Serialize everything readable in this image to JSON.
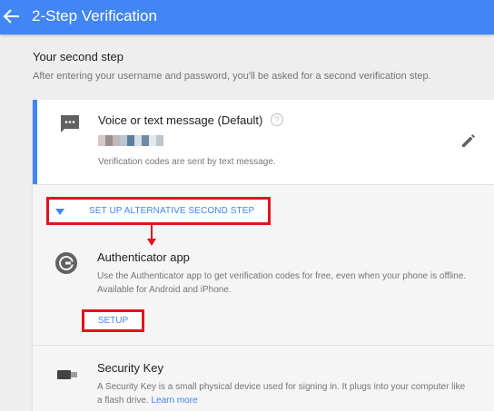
{
  "header": {
    "title": "2-Step Verification",
    "bg_color": "#4285f4"
  },
  "section": {
    "title": "Your second step",
    "subtitle": "After entering your username and password, you'll be asked for a second verification step."
  },
  "primary_method": {
    "title": "Voice or text message (Default)",
    "help_glyph": "?",
    "phone_number_redacted": true,
    "description": "Verification codes are sent by text message.",
    "icons": [
      "message-icon",
      "help-icon",
      "pencil-icon"
    ]
  },
  "alternative": {
    "toggle_label": "SET UP ALTERNATIVE SECOND STEP",
    "methods": [
      {
        "title": "Authenticator app",
        "desc_line1": "Use the Authenticator app to get verification codes for free, even when your phone is offline.",
        "desc_line2": "Available for Android and iPhone.",
        "action_label": "SETUP",
        "icon": "authenticator-icon"
      },
      {
        "title": "Security Key",
        "desc_line1": "A Security Key is a small physical device used for signing in. It plugs into your computer like",
        "desc_line2_text": "a flash drive.",
        "link_label": "Learn more",
        "icon": "usb-key-icon"
      }
    ]
  },
  "colors": {
    "accent": "#4285f4",
    "highlight": "#e0141d",
    "background": "#eeeeee"
  }
}
